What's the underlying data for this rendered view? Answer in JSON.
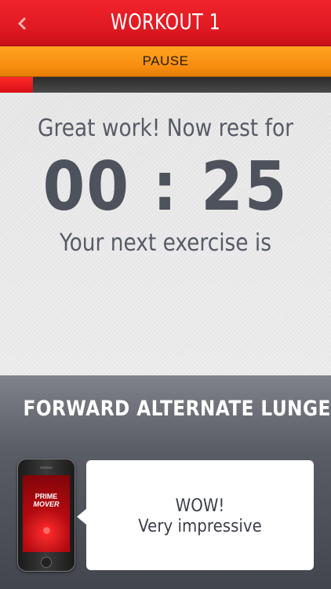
{
  "header": {
    "title": "WORKOUT 1",
    "back_icon": "chevron-left-icon"
  },
  "pause_bar": {
    "label": "PAUSE"
  },
  "progress": {
    "fraction": 0.1
  },
  "rest": {
    "message": "Great work! Now rest for",
    "timer": "00 : 25",
    "next_label": "Your next exercise is"
  },
  "exercise": {
    "name": "FORWARD ALTERNATE LUNGES"
  },
  "phone": {
    "logo_line1": "PRIME",
    "logo_line2": "MOVER"
  },
  "bubble": {
    "line1": "WOW!",
    "line2": "Very impressive"
  },
  "colors": {
    "header_red": "#e01a22",
    "pause_orange": "#f78d10",
    "text_gray": "#575b66"
  }
}
